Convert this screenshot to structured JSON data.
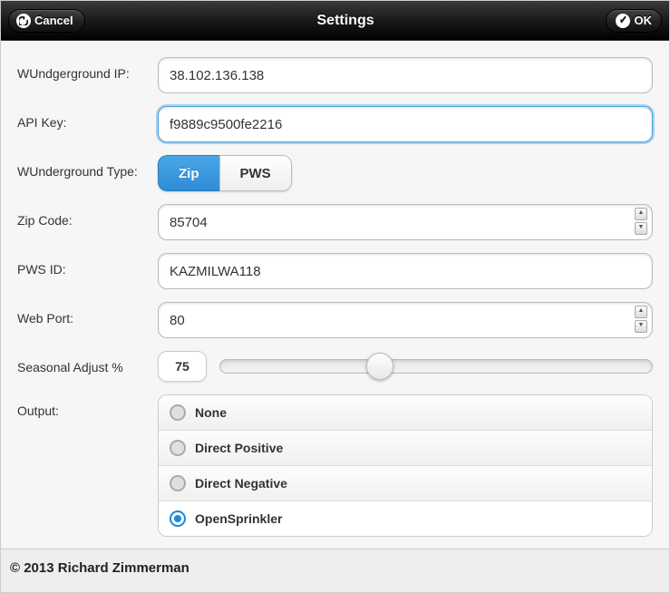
{
  "header": {
    "title": "Settings",
    "cancel": "Cancel",
    "ok": "OK"
  },
  "labels": {
    "wuip": "WUndgerground IP:",
    "apikey": "API Key:",
    "wutype": "WUnderground Type:",
    "zip": "Zip Code:",
    "pws": "PWS ID:",
    "port": "Web Port:",
    "seasonal": "Seasonal Adjust %",
    "output": "Output:"
  },
  "fields": {
    "wuip": "38.102.136.138",
    "apikey": "f9889c9500fe2216",
    "zip": "85704",
    "pws": "KAZMILWA118",
    "port": "80",
    "seasonal": "75",
    "seasonal_pct": 37
  },
  "segment": {
    "zip": "Zip",
    "pws": "PWS",
    "active": "zip"
  },
  "output": {
    "options": [
      {
        "key": "none",
        "label": "None"
      },
      {
        "key": "dpos",
        "label": "Direct Positive"
      },
      {
        "key": "dneg",
        "label": "Direct Negative"
      },
      {
        "key": "osprink",
        "label": "OpenSprinkler"
      }
    ],
    "selected": "osprink"
  },
  "footer": "© 2013 Richard Zimmerman"
}
